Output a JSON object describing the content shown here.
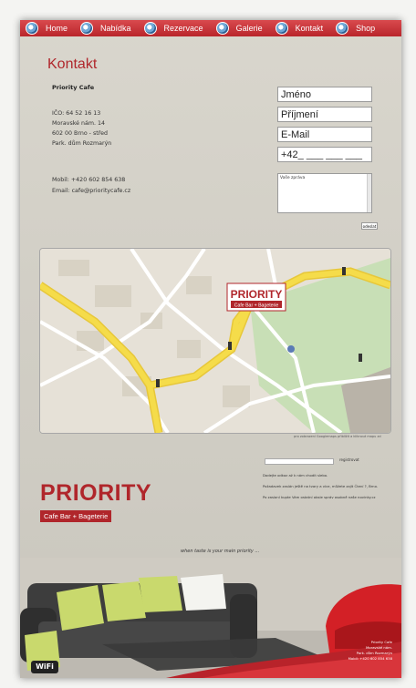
{
  "nav": {
    "items": [
      {
        "label": "Home",
        "icon": "globe-icon"
      },
      {
        "label": "Nabídka",
        "icon": "globe-icon"
      },
      {
        "label": "Rezervace",
        "icon": "globe-icon"
      },
      {
        "label": "Galerie",
        "icon": "globe-icon"
      },
      {
        "label": "Kontakt",
        "icon": "globe-icon"
      },
      {
        "label": "Shop",
        "icon": "globe-icon"
      }
    ]
  },
  "page_title": "Kontakt",
  "company": {
    "name": "Priority Cafe",
    "ico": "IČO: 64 52 16 13",
    "street": "Moravské nám. 14",
    "city": "602 00 Brno - střed",
    "building": "Park. dům Rozmarýn",
    "mobile": "Mobil: +420 602 854 638",
    "email": "Email: cafe@prioritycafe.cz"
  },
  "form": {
    "first_name": "Jméno",
    "last_name": "Příjmení",
    "email": "E-Mail",
    "phone": "+42_ ___ ___ ___",
    "message": "Vaše zpráva",
    "send_label": "odeslat"
  },
  "map": {
    "logo_word": "PRIORITY",
    "logo_sub": "Cafe Bar + Bageterie",
    "caption": "pro zobrazení Googlemaps přiblížit a kliknout mapu zd"
  },
  "newsletter": {
    "button": "registrovat",
    "line1": "Dodejte odkaz až k nám chodit slebo.",
    "line2": "Požadavek zaslán ještě na tvary a více, můžete zajít Čtení ?, Brno.",
    "line3": "Po zaslaní kupte Vám ostatní obsle správ osobně naše novinky.cz"
  },
  "brand": {
    "logo_word": "PRIORITY",
    "logo_sub": "Cafe Bar + Bageterie",
    "slogan": "when taste is your main priority ...",
    "wifi": "WiFi"
  },
  "footer": {
    "line1": "Priority Cafe",
    "line2": "Moravské nám.",
    "line3": "Park. dům Rozmarýn",
    "line4": "Mobil: +420 602 854 638"
  },
  "colors": {
    "accent": "#b0262b",
    "nav": "#c8353a",
    "map_road_major": "#f5dc4a",
    "map_park": "#c8dfb6"
  }
}
